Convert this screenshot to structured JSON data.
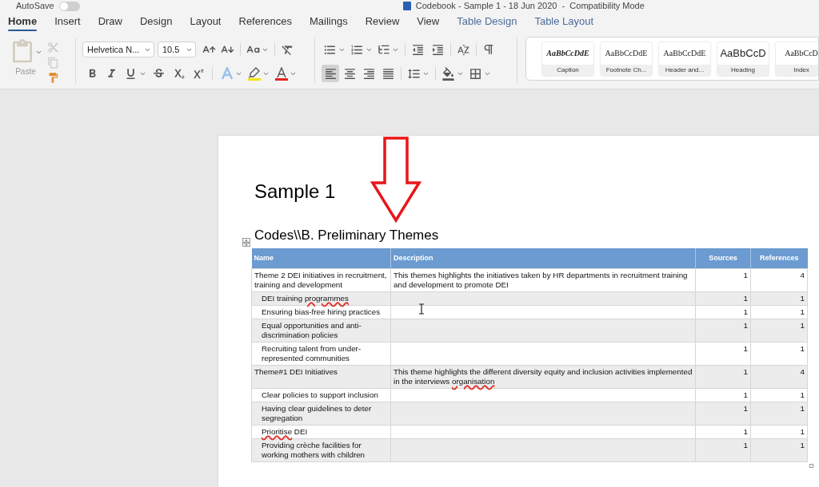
{
  "title_bar": {
    "autosave_label": "AutoSave",
    "autosave_on": false,
    "title": "Codebook - Sample 1 - 18 Jun 2020  -  Compatibility Mode"
  },
  "tabs": [
    {
      "label": "Home",
      "selected": true,
      "contextual": false
    },
    {
      "label": "Insert",
      "selected": false,
      "contextual": false
    },
    {
      "label": "Draw",
      "selected": false,
      "contextual": false
    },
    {
      "label": "Design",
      "selected": false,
      "contextual": false
    },
    {
      "label": "Layout",
      "selected": false,
      "contextual": false
    },
    {
      "label": "References",
      "selected": false,
      "contextual": false
    },
    {
      "label": "Mailings",
      "selected": false,
      "contextual": false
    },
    {
      "label": "Review",
      "selected": false,
      "contextual": false
    },
    {
      "label": "View",
      "selected": false,
      "contextual": false
    },
    {
      "label": "Table Design",
      "selected": false,
      "contextual": true
    },
    {
      "label": "Table Layout",
      "selected": false,
      "contextual": true
    }
  ],
  "ribbon": {
    "clipboard": {
      "paste": {
        "label": "Paste",
        "disabled": true
      },
      "tools": [
        {
          "kind": "cut",
          "disabled": true
        },
        {
          "kind": "copy",
          "disabled": true
        },
        {
          "kind": "format_painter",
          "disabled": false
        }
      ]
    },
    "font": {
      "font_name": "Helvetica N...",
      "font_size": "10.5"
    },
    "paragraph": {
      "alignment": [
        {
          "kind": "left",
          "selected": true
        },
        {
          "kind": "center",
          "selected": false
        },
        {
          "kind": "right",
          "selected": false
        },
        {
          "kind": "justify",
          "selected": false
        }
      ]
    },
    "styles": [
      {
        "preview": "AaBbCcDdE",
        "label": "Caption",
        "kind": "italic_serif"
      },
      {
        "preview": "AaBbCcDdE",
        "label": "Footnote Ch...",
        "kind": "serif"
      },
      {
        "preview": "AaBbCcDdE",
        "label": "Header and...",
        "kind": "serif"
      },
      {
        "preview": "AaBbCcD",
        "label": "Heading",
        "kind": "sans"
      },
      {
        "preview": "AaBbCcD",
        "label": "Index",
        "kind": "serif"
      }
    ]
  },
  "document": {
    "title": "Sample 1",
    "heading": "Codes\\\\B. Preliminary Themes",
    "table": {
      "columns": [
        "Name",
        "Description",
        "Sources",
        "References"
      ],
      "rows": [
        {
          "name": "Theme 2 DEI initiatives in recruitment, training and development",
          "description": "This themes highlights the initiatives taken by HR departments in recruitment training and development to promote DEI",
          "sources": "1",
          "references": "4",
          "children": [
            {
              "name": [
                {
                  "text": "DEI training ",
                  "flagged": false
                },
                {
                  "text": "programmes",
                  "flagged": true
                }
              ],
              "sources": "1",
              "references": "1"
            },
            {
              "name": "Ensuring bias-free hiring practices",
              "sources": "1",
              "references": "1"
            },
            {
              "name": "Equal opportunities and anti-discrimination policies",
              "sources": "1",
              "references": "1"
            },
            {
              "name": "Recruiting talent from under-represented communities",
              "sources": "1",
              "references": "1"
            }
          ]
        },
        {
          "name": "Theme#1 DEI Initiatives",
          "description": [
            {
              "text": "This theme highlights the different diversity equity and inclusion activities implemented in the interviews ",
              "flagged": false
            },
            {
              "text": "organisation",
              "flagged": true
            }
          ],
          "sources": "1",
          "references": "4",
          "children": [
            {
              "name": "Clear policies to support inclusion",
              "sources": "1",
              "references": "1"
            },
            {
              "name": "Having clear guidelines to deter segregation",
              "sources": "1",
              "references": "1"
            },
            {
              "name": [
                {
                  "text": "Prioritise",
                  "flagged": true
                },
                {
                  "text": " DEI",
                  "flagged": false
                }
              ],
              "sources": "1",
              "references": "1"
            },
            {
              "name": "Providing crèche facilities for working mothers with children",
              "sources": "1",
              "references": "1"
            }
          ]
        }
      ]
    }
  }
}
